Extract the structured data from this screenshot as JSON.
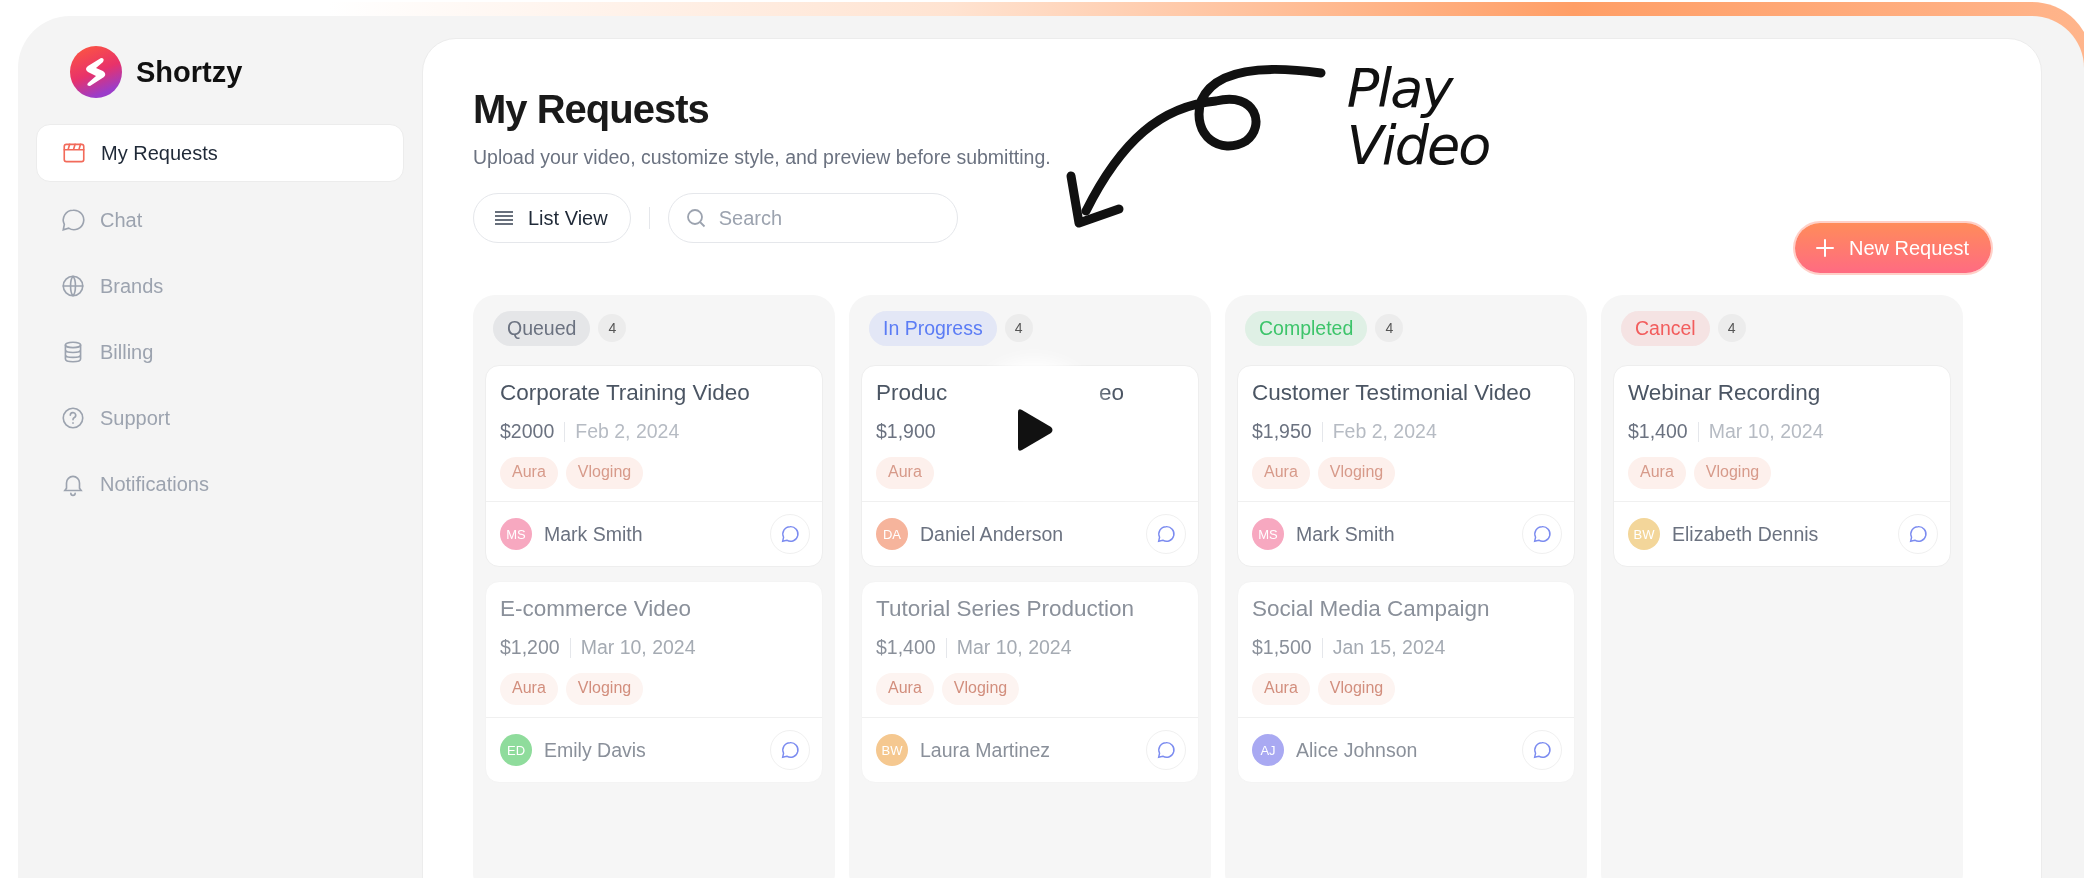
{
  "brand": {
    "name": "Shortzy"
  },
  "sidebar": {
    "items": [
      {
        "label": "My Requests",
        "selected": true
      },
      {
        "label": "Chat",
        "selected": false
      },
      {
        "label": "Brands",
        "selected": false
      },
      {
        "label": "Billing",
        "selected": false
      },
      {
        "label": "Support",
        "selected": false
      },
      {
        "label": "Notifications",
        "selected": false
      }
    ]
  },
  "page": {
    "title": "My Requests",
    "subtitle": "Upload your video, customize style, and preview before submitting."
  },
  "toolbar": {
    "view_button": "List View",
    "search": {
      "placeholder": "Search"
    },
    "new_button": "New Request"
  },
  "annotation": {
    "text": "Play Video"
  },
  "columns": [
    {
      "status": "Queued",
      "color": "#6b7280",
      "count": "4",
      "cards": [
        {
          "title": "Corporate Training Video",
          "price": "$2000",
          "date": "Feb 2, 2024",
          "tags": [
            "Aura",
            "Vloging"
          ],
          "initials": "MS",
          "color": "#f7a8c0",
          "assignee": "Mark Smith",
          "faded": false
        },
        {
          "title": "E-commerce Video",
          "price": "$1,200",
          "date": "Mar 10, 2024",
          "tags": [
            "Aura",
            "Vloging"
          ],
          "initials": "ED",
          "color": "#8fdc9c",
          "assignee": "Emily Davis",
          "faded": true
        }
      ]
    },
    {
      "status": "In Progress",
      "color": "#5b7cf5",
      "count": "4",
      "cards": [
        {
          "title": "Produc",
          "title_end": "eo",
          "price": "$1,900",
          "tags": [
            "Aura"
          ],
          "initials": "DA",
          "color": "#f6b49c",
          "assignee": "Daniel Anderson",
          "faded": false,
          "play_overlay": true
        },
        {
          "title": "Tutorial Series Production",
          "price": "$1,400",
          "date": "Mar 10, 2024",
          "tags": [
            "Aura",
            "Vloging"
          ],
          "initials": "BW",
          "color": "#f5c890",
          "assignee": "Laura Martinez",
          "faded": true
        }
      ]
    },
    {
      "status": "Completed",
      "color": "#3cc46a",
      "count": "4",
      "cards": [
        {
          "title": "Customer Testimonial Video",
          "price": "$1,950",
          "date": "Feb 2, 2024",
          "tags": [
            "Aura",
            "Vloging"
          ],
          "initials": "MS",
          "color": "#f7a8c0",
          "assignee": "Mark Smith",
          "faded": false
        },
        {
          "title": "Social Media Campaign",
          "price": "$1,500",
          "date": "Jan 15, 2024",
          "tags": [
            "Aura",
            "Vloging"
          ],
          "initials": "AJ",
          "color": "#a9a9f2",
          "assignee": "Alice Johnson",
          "faded": true
        }
      ]
    },
    {
      "status": "Cancel",
      "color": "#f25c5c",
      "count": "4",
      "cards": [
        {
          "title": "Webinar Recording",
          "price": "$1,400",
          "date": "Mar 10, 2024",
          "tags": [
            "Aura",
            "Vloging"
          ],
          "initials": "BW",
          "color": "#f3d69a",
          "assignee": "Elizabeth Dennis",
          "faded": false
        }
      ]
    }
  ]
}
